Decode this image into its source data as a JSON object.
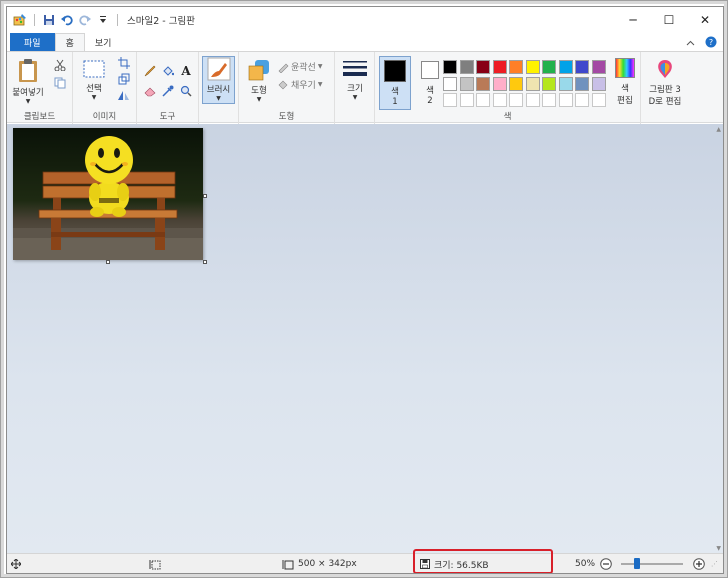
{
  "window": {
    "title": "스마일2 - 그림판",
    "buttons": {
      "minimize": "─",
      "maximize": "☐",
      "close": "✕"
    }
  },
  "tabs": [
    {
      "label": "파일"
    },
    {
      "label": "홈"
    },
    {
      "label": "보기"
    }
  ],
  "ribbon": {
    "clipboard": {
      "label": "클립보드",
      "paste": "붙여넣기"
    },
    "image": {
      "label": "이미지",
      "select": "선택"
    },
    "tools": {
      "label": "도구"
    },
    "brushes": {
      "label": "브러시"
    },
    "shapes": {
      "label": "도형",
      "shapes_btn": "도형",
      "outline": "윤곽선",
      "fill": "채우기"
    },
    "size": {
      "label": "크기"
    },
    "colors": {
      "label": "색",
      "color1": "색\n1",
      "color1_a": "색",
      "color1_b": "1",
      "color2_a": "색",
      "color2_b": "2",
      "edit_a": "색",
      "edit_b": "편집",
      "paint3d_a": "그림판 3",
      "paint3d_b": "D로 편집",
      "palette_row1": [
        "#000000",
        "#7f7f7f",
        "#880015",
        "#ed1c24",
        "#ff7f27",
        "#fff200",
        "#22b14c",
        "#00a2e8",
        "#3f48cc",
        "#a349a4"
      ],
      "palette_row2": [
        "#ffffff",
        "#c3c3c3",
        "#b97a57",
        "#ffaec9",
        "#ffc90e",
        "#efe4b0",
        "#b5e61d",
        "#99d9ea",
        "#7092be",
        "#c8bfe7"
      ],
      "palette_row3": [
        "#ffffff",
        "#ffffff",
        "#ffffff",
        "#ffffff",
        "#ffffff",
        "#ffffff",
        "#ffffff",
        "#ffffff",
        "#ffffff",
        "#ffffff"
      ]
    }
  },
  "status": {
    "dimensions": "500 × 342px",
    "size": "크기: 56.5KB",
    "zoom": "50%",
    "zoom_fraction": 0.25
  },
  "colors": {
    "accent": "#1e6fc8",
    "highlight": "#d8202a"
  }
}
